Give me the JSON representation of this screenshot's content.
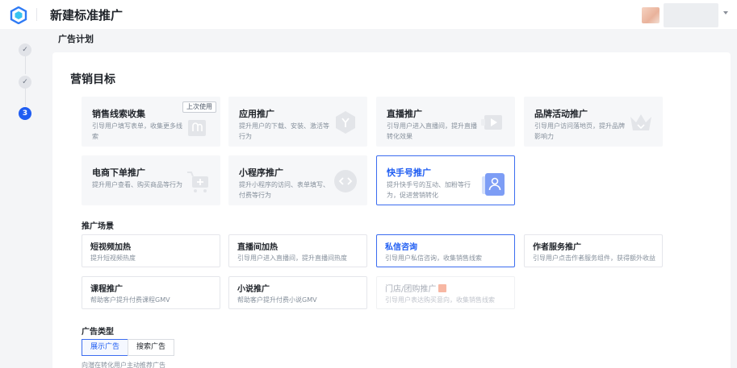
{
  "header": {
    "title": "新建标准推广"
  },
  "steps": [
    {
      "label": "✓",
      "state": "done"
    },
    {
      "label": "✓",
      "state": "done"
    },
    {
      "label": "3",
      "state": "active"
    }
  ],
  "plan_label": "广告计划",
  "marketing": {
    "title": "营销目标",
    "goals": [
      {
        "title": "销售线索收集",
        "desc": "引导用户填写表单，收集更多线索",
        "badge": "上次使用",
        "icon": "form-icon"
      },
      {
        "title": "应用推广",
        "desc": "提升用户的下载、安装、激活等行为",
        "icon": "app-hexagon-icon"
      },
      {
        "title": "直播推广",
        "desc": "引导用户进入直播间，提升直播转化效果",
        "icon": "live-play-icon"
      },
      {
        "title": "品牌活动推广",
        "desc": "引导用户访问落地页，提升品牌影响力",
        "icon": "crown-icon"
      },
      {
        "title": "电商下单推广",
        "desc": "提升用户查看、购买商品等行为",
        "icon": "cart-icon"
      },
      {
        "title": "小程序推广",
        "desc": "提升小程序的访问、表单填写、付费等行为",
        "icon": "mini-program-icon"
      },
      {
        "title": "快手号推广",
        "desc": "提升快手号的互动、加粉等行为，促进营销转化",
        "icon": "user-card-icon",
        "selected": true
      }
    ]
  },
  "scenes": {
    "label": "推广场景",
    "items": [
      {
        "title": "短视频加热",
        "desc": "提升短视频热度"
      },
      {
        "title": "直播间加热",
        "desc": "引导用户进入直播间，提升直播间热度"
      },
      {
        "title": "私信咨询",
        "desc": "引导用户私信咨询，收集销售线索",
        "selected": true
      },
      {
        "title": "作者服务推广",
        "desc": "引导用户点击作者服务组件，获得额外收益"
      },
      {
        "title": "课程推广",
        "desc": "帮助客户提升付费课程GMV"
      },
      {
        "title": "小说推广",
        "desc": "帮助客户提升付费小说GMV"
      },
      {
        "title": "门店/团购推广",
        "desc": "引导用户表达购买意向，收集销售线索",
        "disabled": true,
        "tag_icon": "new-tag-icon"
      }
    ]
  },
  "ad_type": {
    "label": "广告类型",
    "options": [
      "展示广告",
      "搜索广告"
    ],
    "selected": "展示广告",
    "hint": "向潜在转化用户主动推荐广告"
  },
  "colors": {
    "accent": "#1f5df2",
    "selected_border": "#3b6cf0",
    "page_bg": "#f4f5f7"
  }
}
